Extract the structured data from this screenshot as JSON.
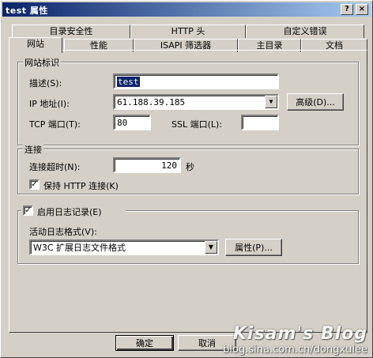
{
  "window": {
    "title": "test 属性",
    "help_btn": "?",
    "close_btn": "×"
  },
  "tabs_back": [
    "目录安全性",
    "HTTP 头",
    "自定义错误"
  ],
  "tabs_front": [
    "网站",
    "性能",
    "ISAPI 筛选器",
    "主目录",
    "文档"
  ],
  "site_id": {
    "group_title": "网站标识",
    "desc_label": "描述(S):",
    "desc_value": "test",
    "ip_label": "IP 地址(I):",
    "ip_value": "61.188.39.185",
    "advanced_btn": "高级(D)...",
    "tcp_label": "TCP 端口(T):",
    "tcp_value": "80",
    "ssl_label": "SSL 端口(L):",
    "ssl_value": ""
  },
  "connection": {
    "group_title": "连接",
    "timeout_label": "连接超时(N):",
    "timeout_value": "120",
    "timeout_unit": "秒",
    "keepalive_label": "保持 HTTP 连接(K)",
    "keepalive_checked": true
  },
  "logging": {
    "enable_label": "启用日志记录(E)",
    "enable_checked": true,
    "format_label": "活动日志格式(V):",
    "format_value": "W3C 扩展日志文件格式",
    "props_btn": "属性(P)..."
  },
  "footer": {
    "ok": "确定",
    "cancel": "取消"
  },
  "watermark": {
    "line1": "Kisam's Blog",
    "line2": "blog.sina.com.cn/dongxulee"
  }
}
